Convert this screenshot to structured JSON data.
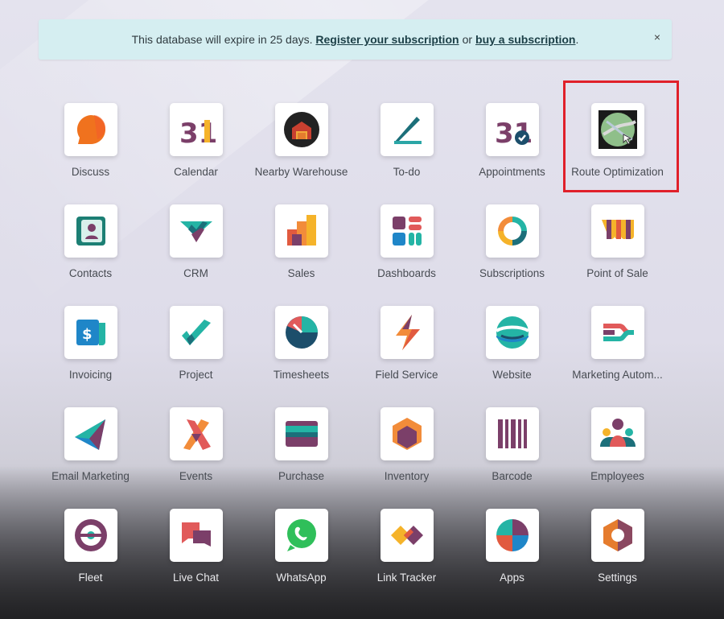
{
  "banner": {
    "prefix": "This database will expire in 25 days.",
    "register_link": "Register your subscription",
    "or": "or",
    "buy_link": "buy a subscription",
    "suffix": ".",
    "close": "×"
  },
  "apps": [
    {
      "label": "Discuss",
      "icon": "discuss-icon"
    },
    {
      "label": "Calendar",
      "icon": "calendar-icon"
    },
    {
      "label": "Nearby Warehouse",
      "icon": "warehouse-icon"
    },
    {
      "label": "To-do",
      "icon": "todo-icon"
    },
    {
      "label": "Appointments",
      "icon": "appointments-icon"
    },
    {
      "label": "Route Optimization",
      "icon": "route-optimization-icon"
    },
    {
      "label": "Contacts",
      "icon": "contacts-icon"
    },
    {
      "label": "CRM",
      "icon": "crm-icon"
    },
    {
      "label": "Sales",
      "icon": "sales-icon"
    },
    {
      "label": "Dashboards",
      "icon": "dashboards-icon"
    },
    {
      "label": "Subscriptions",
      "icon": "subscriptions-icon"
    },
    {
      "label": "Point of Sale",
      "icon": "point-of-sale-icon"
    },
    {
      "label": "Invoicing",
      "icon": "invoicing-icon"
    },
    {
      "label": "Project",
      "icon": "project-icon"
    },
    {
      "label": "Timesheets",
      "icon": "timesheets-icon"
    },
    {
      "label": "Field Service",
      "icon": "field-service-icon"
    },
    {
      "label": "Website",
      "icon": "website-icon"
    },
    {
      "label": "Marketing Autom...",
      "icon": "marketing-automation-icon"
    },
    {
      "label": "Email Marketing",
      "icon": "email-marketing-icon"
    },
    {
      "label": "Events",
      "icon": "events-icon"
    },
    {
      "label": "Purchase",
      "icon": "purchase-icon"
    },
    {
      "label": "Inventory",
      "icon": "inventory-icon"
    },
    {
      "label": "Barcode",
      "icon": "barcode-icon"
    },
    {
      "label": "Employees",
      "icon": "employees-icon"
    },
    {
      "label": "Fleet",
      "icon": "fleet-icon"
    },
    {
      "label": "Live Chat",
      "icon": "live-chat-icon"
    },
    {
      "label": "WhatsApp",
      "icon": "whatsapp-icon"
    },
    {
      "label": "Link Tracker",
      "icon": "link-tracker-icon"
    },
    {
      "label": "Apps",
      "icon": "apps-icon"
    },
    {
      "label": "Settings",
      "icon": "settings-icon"
    }
  ],
  "calendar_day": "31",
  "colors": {
    "highlight": "#e0202a",
    "banner_bg": "#d5eef1"
  }
}
